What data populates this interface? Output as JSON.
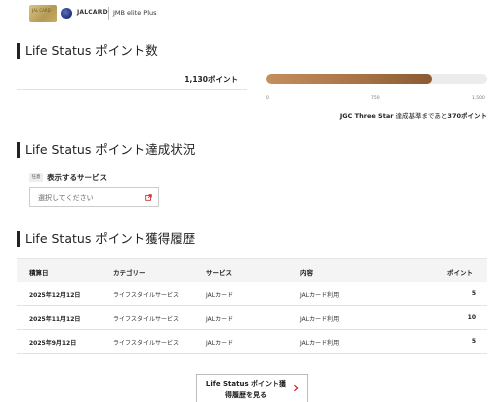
{
  "header": {
    "card_text": "JAL CARD",
    "brand": "JALCARD",
    "program": "JMB elite Plus"
  },
  "points_section": {
    "title": "Life Status ポイント数",
    "current_points": "1,130ポイント",
    "progress_current": 1130,
    "progress_max": 1500,
    "ticks": [
      "0",
      "750",
      "1,500"
    ],
    "goal_prefix": "JGC Three Star",
    "goal_middle": " 達成基準まであと",
    "goal_remaining": "370ポイント"
  },
  "status_section": {
    "title": "Life Status ポイント達成状況",
    "optional_badge": "任意",
    "service_label": "表示するサービス",
    "service_placeholder": "選択してください"
  },
  "history_section": {
    "title": "Life Status ポイント獲得履歴",
    "columns": [
      "積算日",
      "カテゴリー",
      "サービス",
      "内容",
      "ポイント"
    ],
    "rows": [
      {
        "date": "2025年12月12日",
        "category": "ライフスタイルサービス",
        "service": "JALカード",
        "content": "JALカード利用",
        "points": "5"
      },
      {
        "date": "2025年11月12日",
        "category": "ライフスタイルサービス",
        "service": "JALカード",
        "content": "JALカード利用",
        "points": "10"
      },
      {
        "date": "2025年9月12日",
        "category": "ライフスタイルサービス",
        "service": "JALカード",
        "content": "JALカード利用",
        "points": "5"
      }
    ],
    "more_button": "Life Status ポイント獲得履歴を見る"
  },
  "colors": {
    "bar_fill": "#a87446",
    "bar_track": "#ececec",
    "heading_accent": "#222222",
    "external_icon": "#d0262b"
  },
  "icons": [
    "jal-card-image",
    "jal-crane-logo",
    "external-link-icon",
    "chevron-right-icon"
  ]
}
